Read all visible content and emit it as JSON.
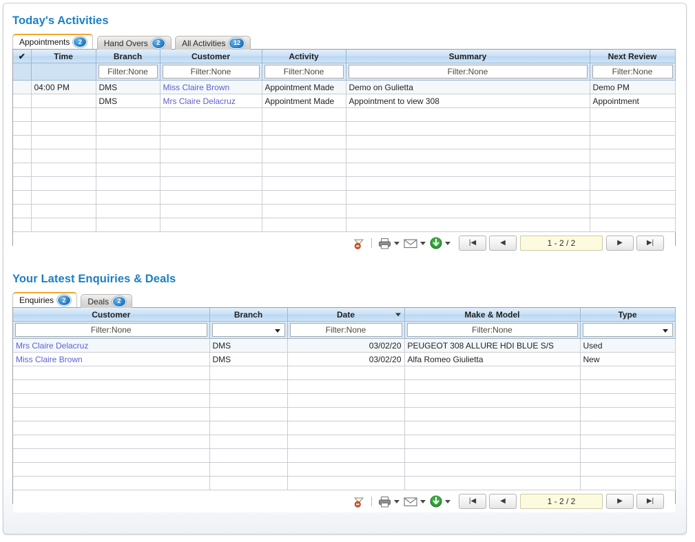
{
  "activities": {
    "title": "Today's Activities",
    "tabs": [
      {
        "label": "Appointments",
        "count": "2",
        "active": true
      },
      {
        "label": "Hand Overs",
        "count": "2",
        "active": false
      },
      {
        "label": "All Activities",
        "count": "12",
        "active": false
      }
    ],
    "columns": [
      "",
      "Time",
      "Branch",
      "Customer",
      "Activity",
      "Summary",
      "Next Review"
    ],
    "filters": [
      "",
      "",
      "Filter:None",
      "Filter:None",
      "Filter:None",
      "Filter:None",
      "Filter:None"
    ],
    "rows": [
      {
        "check": "",
        "time": "04:00 PM",
        "branch": "DMS",
        "customer": "Miss Claire Brown",
        "activity": "Appointment Made",
        "summary": "Demo on Gulietta",
        "next_review": "Demo PM"
      },
      {
        "check": "",
        "time": "",
        "branch": "DMS",
        "customer": "Mrs Claire Delacruz",
        "activity": "Appointment Made",
        "summary": "Appointment to view 308",
        "next_review": "Appointment"
      }
    ],
    "empty_row_count": 9,
    "pager": {
      "range": "1 - 2 / 2",
      "first_label": "|◀",
      "prev_label": "◀",
      "next_label": "▶",
      "last_label": "▶|"
    }
  },
  "enquiries": {
    "title": "Your Latest Enquiries & Deals",
    "tabs": [
      {
        "label": "Enquiries",
        "count": "2",
        "active": true
      },
      {
        "label": "Deals",
        "count": "2",
        "active": false
      }
    ],
    "columns": [
      "Customer",
      "Branch",
      "Date",
      "Make & Model",
      "Type"
    ],
    "sorted_column": "Date",
    "sort_direction": "desc",
    "filters": [
      "Filter:None",
      "",
      "Filter:None",
      "Filter:None",
      ""
    ],
    "rows": [
      {
        "customer": "Mrs Claire Delacruz",
        "branch": "DMS",
        "date": "03/02/20",
        "make_model": "PEUGEOT 308 ALLURE HDI BLUE S/S",
        "type": "Used"
      },
      {
        "customer": "Miss Claire Brown",
        "branch": "DMS",
        "date": "03/02/20",
        "make_model": "Alfa Romeo Giulietta",
        "type": "New"
      }
    ],
    "empty_row_count": 9,
    "pager": {
      "range": "1 - 2 / 2",
      "first_label": "|◀",
      "prev_label": "◀",
      "next_label": "▶",
      "last_label": "▶|"
    }
  },
  "toolbar_icons": {
    "clear_filter": "clear-filter-icon",
    "print": "print-icon",
    "email": "email-icon",
    "export": "export-icon"
  },
  "colors": {
    "title": "#1b7fc4",
    "header_blue": "#cbe1f5",
    "link": "#5b61d6",
    "tab_active_accent": "#f0a72c",
    "pager_field": "#fdfbdf"
  }
}
